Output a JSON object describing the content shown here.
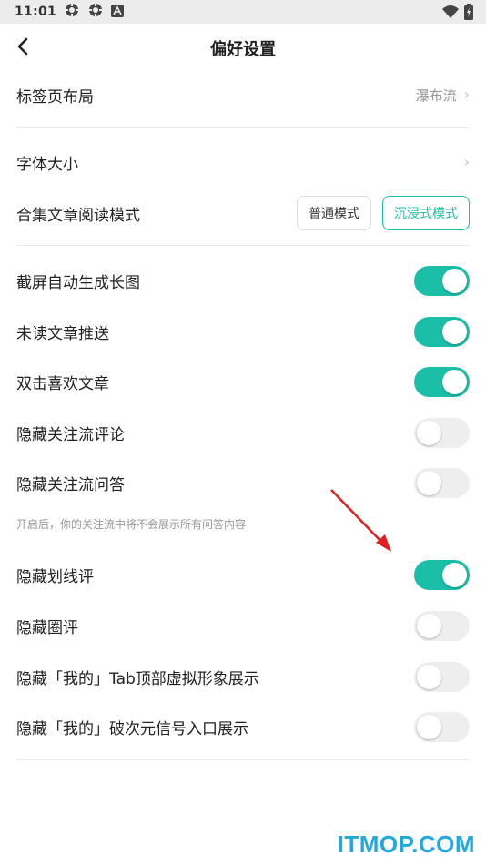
{
  "status_bar": {
    "time": "11:01",
    "icons": [
      "settings-sync-icon",
      "settings-sync-icon",
      "font-app-icon",
      "wifi-icon",
      "battery-charging-icon"
    ]
  },
  "header": {
    "title": "偏好设置",
    "back_icon": "back-arrow-icon"
  },
  "rows": {
    "tab_layout": {
      "label": "标签页布局",
      "value": "瀑布流"
    },
    "font_size": {
      "label": "字体大小"
    },
    "collection_mode": {
      "label": "合集文章阅读模式",
      "option_normal": "普通模式",
      "option_immersive": "沉浸式模式",
      "selected": "沉浸式模式"
    },
    "screenshot_long_image": {
      "label": "截屏自动生成长图",
      "on": true
    },
    "unread_push": {
      "label": "未读文章推送",
      "on": true
    },
    "double_tap_like": {
      "label": "双击喜欢文章",
      "on": true
    },
    "hide_follow_comments": {
      "label": "隐藏关注流评论",
      "on": false
    },
    "hide_follow_qa": {
      "label": "隐藏关注流问答",
      "on": false,
      "note": "开启后，你的关注流中将不会展示所有问答内容"
    },
    "hide_underline_comments": {
      "label": "隐藏划线评",
      "on": true
    },
    "hide_circle_comments": {
      "label": "隐藏圈评",
      "on": false
    },
    "hide_avatar_on_mine": {
      "label": "隐藏「我的」Tab顶部虚拟形象展示",
      "on": false
    },
    "hide_anime_entry": {
      "label": "隐藏「我的」破次元信号入口展示",
      "on": false
    }
  },
  "colors": {
    "accent": "#1bbfa8",
    "annotation_arrow": "#e02020",
    "watermark": "#1fa9e0"
  },
  "watermark": "ITMOP.COM"
}
